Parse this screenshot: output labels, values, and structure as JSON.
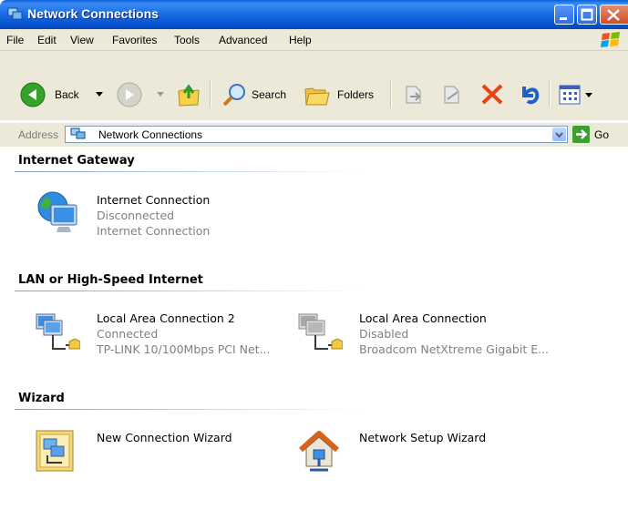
{
  "window": {
    "title": "Network Connections"
  },
  "menu": [
    "File",
    "Edit",
    "View",
    "Favorites",
    "Tools",
    "Advanced",
    "Help"
  ],
  "toolbar": {
    "back": "Back",
    "search": "Search",
    "folders": "Folders"
  },
  "address": {
    "label": "Address",
    "value": "Network Connections",
    "go": "Go"
  },
  "groups": [
    {
      "title": "Internet Gateway",
      "items": [
        {
          "name": "Internet Connection",
          "status": "Disconnected",
          "device": "Internet Connection"
        }
      ]
    },
    {
      "title": "LAN or High-Speed Internet",
      "items": [
        {
          "name": "Local Area Connection 2",
          "status": "Connected",
          "device": "TP-LINK 10/100Mbps PCI Net..."
        },
        {
          "name": "Local Area Connection",
          "status": "Disabled",
          "device": "Broadcom NetXtreme Gigabit E..."
        }
      ]
    },
    {
      "title": "Wizard",
      "items": [
        {
          "name": "New Connection Wizard"
        },
        {
          "name": "Network Setup Wizard"
        }
      ]
    }
  ]
}
